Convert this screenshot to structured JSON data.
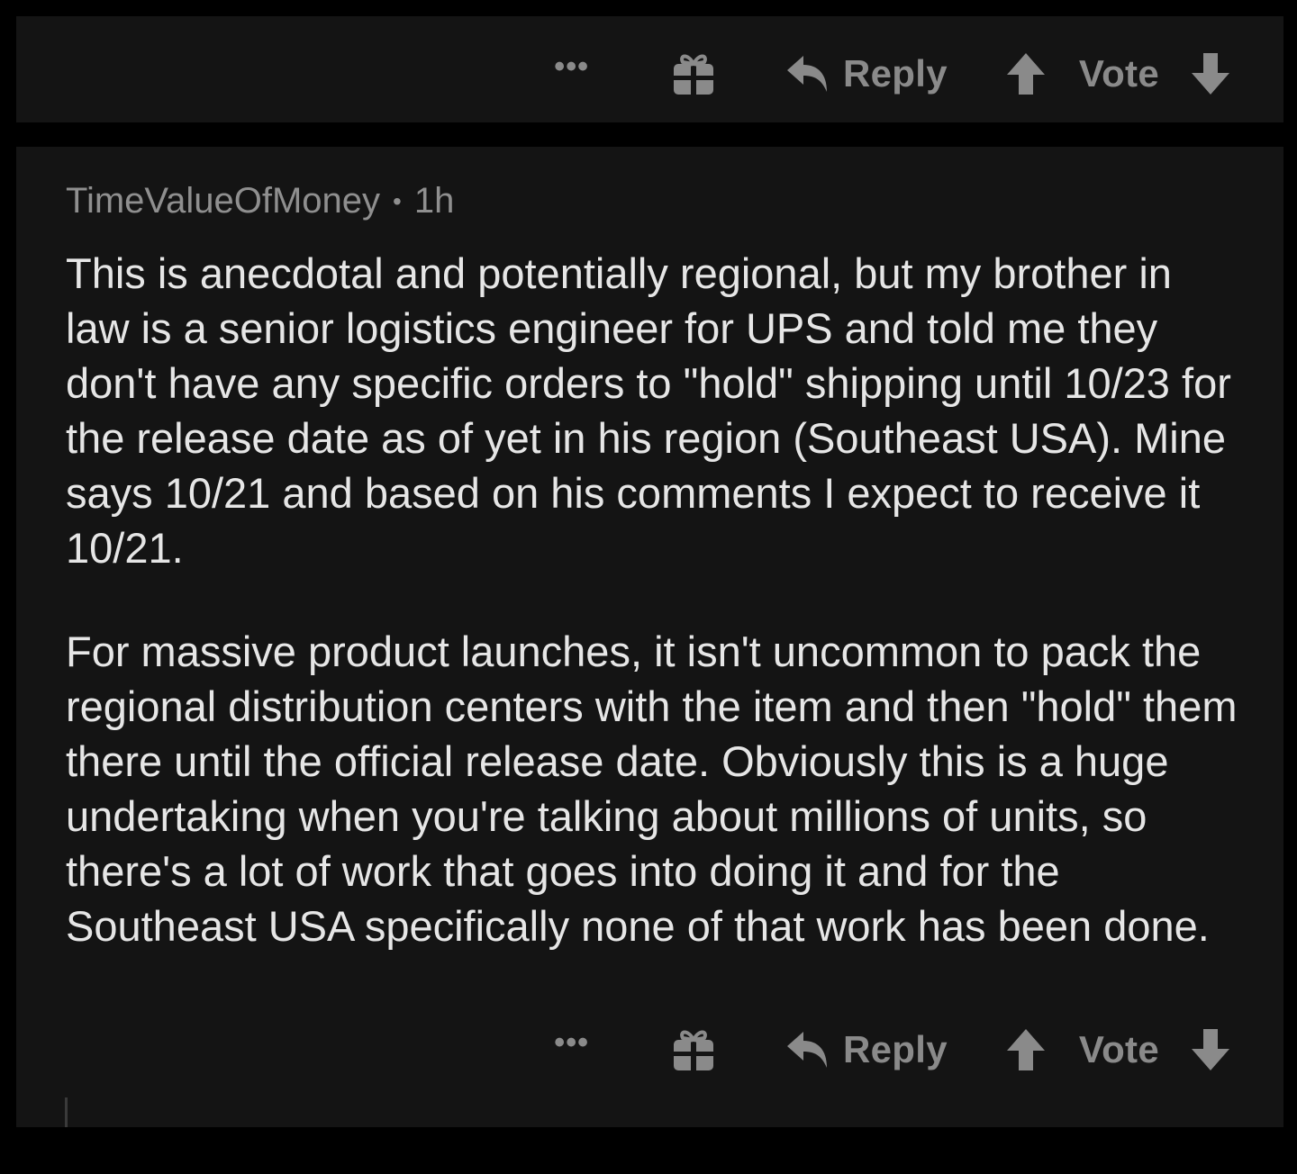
{
  "top_actions": {
    "more_label": "•••",
    "reply_label": "Reply",
    "vote_label": "Vote",
    "icons": [
      "more-icon",
      "gift-icon",
      "reply-icon",
      "upvote-icon",
      "downvote-icon"
    ]
  },
  "comment": {
    "author": "TimeValueOfMoney",
    "separator": "•",
    "age": "1h",
    "paragraphs": [
      "This is anecdotal and potentially regional, but my brother in law is a senior logistics engineer for UPS and told me they don't have any specific orders to \"hold\" shipping until 10/23 for the release date as of yet in his region (Southeast USA). Mine says 10/21 and based on his comments I expect to receive it 10/21.",
      "For massive product launches, it isn't uncommon to pack the regional distribution centers with the item and then \"hold\" them there until the official release date. Obviously this is a huge undertaking when you're talking about millions of units, so there's a lot of work that goes into doing it and for the Southeast USA specifically none of that work has been done."
    ],
    "actions": {
      "more_label": "•••",
      "reply_label": "Reply",
      "vote_label": "Vote"
    }
  },
  "colors": {
    "background": "#000000",
    "card": "#141414",
    "text_primary": "#e6e6e6",
    "text_secondary": "#8a8a8a"
  }
}
